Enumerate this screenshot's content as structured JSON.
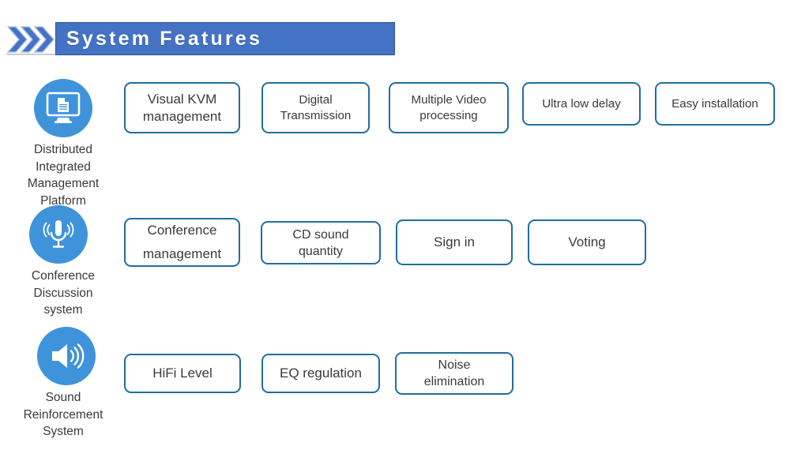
{
  "header": {
    "title": "System Features",
    "chevron_icon": "triple-chevron-right-icon",
    "bar_color": "#4472C4",
    "title_color": "#FFFFFF"
  },
  "theme": {
    "icon_circle_color": "#3F93DB",
    "box_border_color": "#1F6EA0",
    "text_color": "#3A3A3A",
    "background": "#FFFFFF"
  },
  "categories": [
    {
      "id": "distributed-integrated-management-platform",
      "icon": "monitor-document-icon",
      "label": "Distributed\nIntegrated\nManagement\nPlatform",
      "label_lines": [
        "Distributed",
        "Integrated",
        "Management",
        "Platform"
      ],
      "features": [
        "Visual KVM management",
        "Digital Transmission",
        "Multiple Video processing",
        "Ultra low delay",
        "Easy installation"
      ]
    },
    {
      "id": "conference-discussion-system",
      "icon": "microphone-soundwaves-icon",
      "label": "Conference\nDiscussion\nsystem",
      "label_lines": [
        "Conference",
        "Discussion",
        "system"
      ],
      "features": [
        "Conference management",
        "CD sound quantity",
        "Sign in",
        "Voting"
      ]
    },
    {
      "id": "sound-reinforcement-system",
      "icon": "speaker-volume-icon",
      "label": "Sound\nReinforcement\nSystem",
      "label_lines": [
        "Sound",
        "Reinforcement",
        "System"
      ],
      "features": [
        "HiFi Level",
        "EQ regulation",
        "Noise elimination"
      ]
    }
  ],
  "boxes": {
    "b0": {
      "line1": "Visual KVM",
      "line2": "management"
    },
    "b1": {
      "line1": "Digital",
      "line2": "Transmission"
    },
    "b2": {
      "line1": "Multiple Video",
      "line2": "processing"
    },
    "b3": {
      "line1": "Ultra low delay",
      "line2": ""
    },
    "b4": {
      "line1": "Easy installation",
      "line2": ""
    },
    "b5": {
      "line1": "Conference",
      "line2": "management"
    },
    "b6": {
      "line1": "CD sound",
      "line2": "quantity"
    },
    "b7": {
      "line1": "Sign in",
      "line2": ""
    },
    "b8": {
      "line1": "Voting",
      "line2": ""
    },
    "b9": {
      "line1": "HiFi Level",
      "line2": ""
    },
    "b10": {
      "line1": "EQ regulation",
      "line2": ""
    },
    "b11": {
      "line1": "Noise",
      "line2": "elimination"
    }
  },
  "cat_labels": {
    "c0": {
      "l1": "Distributed",
      "l2": "Integrated",
      "l3": "Management",
      "l4": "Platform"
    },
    "c1": {
      "l1": "Conference",
      "l2": "Discussion",
      "l3": "system",
      "l4": ""
    },
    "c2": {
      "l1": "Sound",
      "l2": "Reinforcement",
      "l3": "System",
      "l4": ""
    }
  }
}
